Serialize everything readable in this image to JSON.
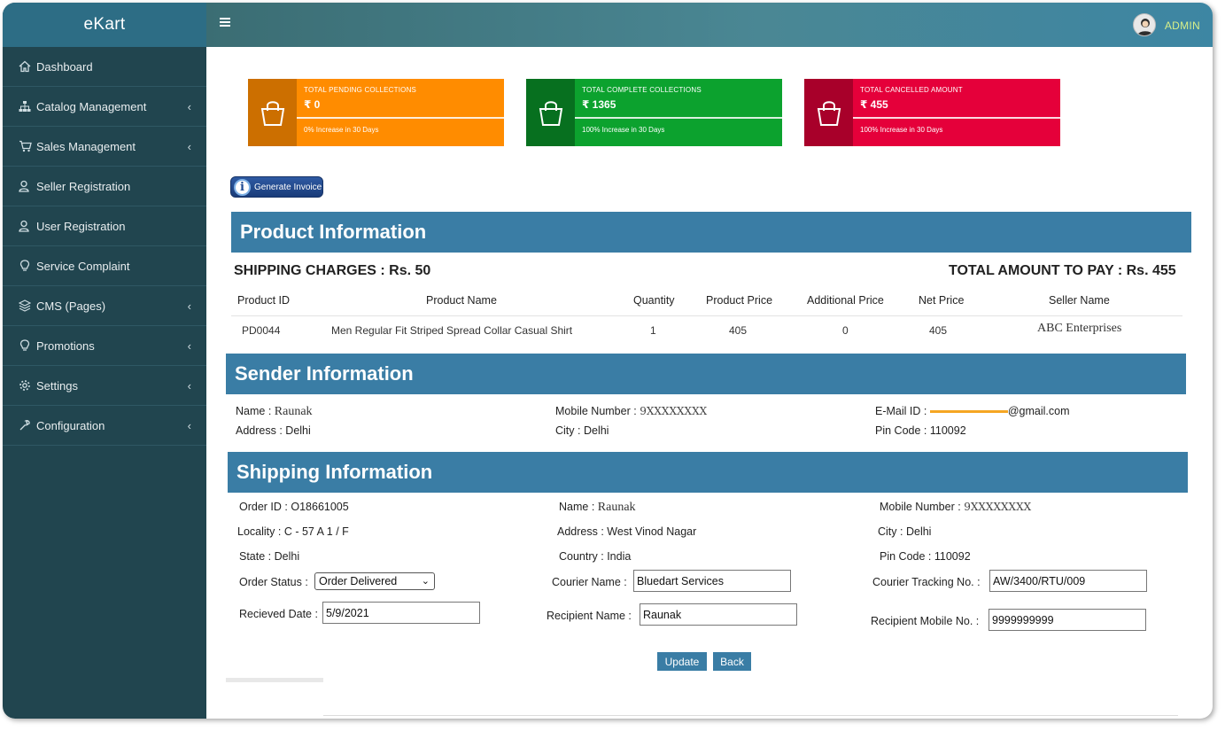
{
  "app": {
    "brand": "eKart",
    "user_label": "ADMIN"
  },
  "sidebar": {
    "items": [
      {
        "label": "Dashboard",
        "icon": "home-icon",
        "has_submenu": false
      },
      {
        "label": "Catalog Management",
        "icon": "sitemap-icon",
        "has_submenu": true
      },
      {
        "label": "Sales Management",
        "icon": "cart-icon",
        "has_submenu": true
      },
      {
        "label": "Seller Registration",
        "icon": "user-icon",
        "has_submenu": false
      },
      {
        "label": "User Registration",
        "icon": "user-icon",
        "has_submenu": false
      },
      {
        "label": "Service Complaint",
        "icon": "lightbulb-icon",
        "has_submenu": false
      },
      {
        "label": "CMS (Pages)",
        "icon": "layers-icon",
        "has_submenu": true
      },
      {
        "label": "Promotions",
        "icon": "lightbulb-icon",
        "has_submenu": true
      },
      {
        "label": "Settings",
        "icon": "gear-icon",
        "has_submenu": true
      },
      {
        "label": "Configuration",
        "icon": "wrench-icon",
        "has_submenu": true
      }
    ]
  },
  "cards": [
    {
      "title": "TOTAL PENDING COLLECTIONS",
      "value": "₹ 0",
      "foot": "0% Increase in 30 Days",
      "color": "#ff8c00",
      "dark": "#cc6f00"
    },
    {
      "title": "TOTAL COMPLETE COLLECTIONS",
      "value": "₹ 1365",
      "foot": "100% Increase in 30 Days",
      "color": "#0ca22e",
      "dark": "#07701f"
    },
    {
      "title": "TOTAL CANCELLED AMOUNT",
      "value": "₹ 455",
      "foot": "100% Increase in 30 Days",
      "color": "#e5003a",
      "dark": "#a8002a"
    }
  ],
  "generate_invoice_label": "Generate Invoice",
  "product": {
    "heading": "Product Information",
    "shipping_charges": "SHIPPING CHARGES : Rs. 50",
    "total_amount": "TOTAL AMOUNT TO PAY : Rs. 455",
    "columns": [
      "Product ID",
      "Product Name",
      "Quantity",
      "Product Price",
      "Additional Price",
      "Net Price",
      "Seller Name"
    ],
    "row": [
      "PD0044",
      "Men Regular Fit Striped Spread Collar Casual Shirt",
      "1",
      "405",
      "0",
      "405",
      "ABC Enterprises"
    ]
  },
  "sender": {
    "heading": "Sender Information",
    "name_label": "Name :",
    "name": "Raunak",
    "mobile_label": "Mobile Number :",
    "mobile": "9XXXXXXXX",
    "email_label": "E-Mail ID :",
    "email_suffix": "@gmail.com",
    "address_label": "Address :",
    "address": "Delhi",
    "city_label": "City :",
    "city": "Delhi",
    "pin_label": "Pin Code :",
    "pin": "110092"
  },
  "shipping": {
    "heading": "Shipping Information",
    "order_id_label": "Order ID :",
    "order_id": "O18661005",
    "name_label": "Name :",
    "name": "Raunak",
    "mobile_label": "Mobile Number :",
    "mobile": "9XXXXXXXX",
    "locality_label": "Locality :",
    "locality": "C - 57 A 1 / F",
    "address_label": "Address :",
    "address": "West Vinod Nagar",
    "city_label": "City :",
    "city": "Delhi",
    "state_label": "State :",
    "state": "Delhi",
    "country_label": "Country :",
    "country": "India",
    "pin_label": "Pin Code :",
    "pin": "110092",
    "order_status_label": "Order Status :",
    "order_status": "Order Delivered",
    "courier_name_label": "Courier Name :",
    "courier_name": "Bluedart Services",
    "tracking_label": "Courier Tracking No. :",
    "tracking": "AW/3400/RTU/009",
    "received_date_label": "Recieved Date :",
    "received_date": "5/9/2021",
    "recipient_name_label": "Recipient Name :",
    "recipient_name": "Raunak",
    "recipient_mobile_label": "Recipient Mobile No. :",
    "recipient_mobile": "9999999999"
  },
  "actions": {
    "update": "Update",
    "back": "Back"
  }
}
